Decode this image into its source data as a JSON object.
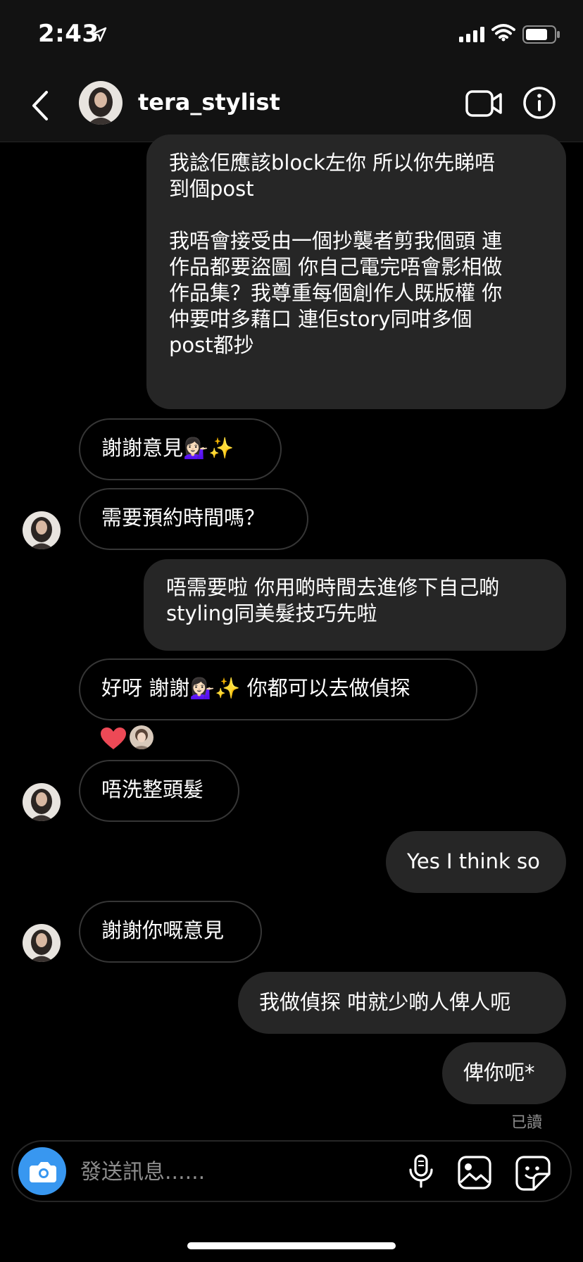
{
  "status_bar": {
    "time": "2:43"
  },
  "header": {
    "username": "tera_stylist"
  },
  "messages": [
    {
      "from": "me",
      "text": "我諗佢應該block左你 所以你先睇唔\n到個post\n\n我唔會接受由一個抄襲者剪我個頭 連\n作品都要盜圖 你自己電完唔會影相做\n作品集？我尊重每個創作人既版權 你\n仲要咁多藉口 連佢story同咁多個\npost都抄"
    },
    {
      "from": "them",
      "text": "謝謝意見💁🏻‍♀️✨"
    },
    {
      "from": "them",
      "text": "需要預約時間嗎？"
    },
    {
      "from": "me",
      "text": "唔需要啦 你用啲時間去進修下自己啲\nstyling同美髮技巧先啦"
    },
    {
      "from": "them",
      "text": "好呀 謝謝💁🏻‍♀️✨ 你都可以去做偵探"
    },
    {
      "from": "them",
      "text": "唔洗整頭髮"
    },
    {
      "from": "me",
      "text": "Yes I think so"
    },
    {
      "from": "them",
      "text": "謝謝你嘅意見"
    },
    {
      "from": "me",
      "text": "我做偵探 咁就少啲人俾人呃"
    },
    {
      "from": "me",
      "text": "俾你呃*"
    }
  ],
  "reactions": {
    "emoji": "heart"
  },
  "seen_label": "已讀",
  "composer": {
    "placeholder": "發送訊息......"
  },
  "colors": {
    "background": "#000000",
    "bubble_me": "#262626",
    "bubble_them_border": "#363636",
    "accent": "#3897f0",
    "heart": "#ed4956"
  },
  "icons": [
    "location-arrow-icon",
    "signal-icon",
    "wifi-icon",
    "battery-icon",
    "back-icon",
    "video-call-icon",
    "info-icon",
    "camera-icon",
    "microphone-icon",
    "gallery-icon",
    "sticker-icon",
    "heart-icon"
  ]
}
